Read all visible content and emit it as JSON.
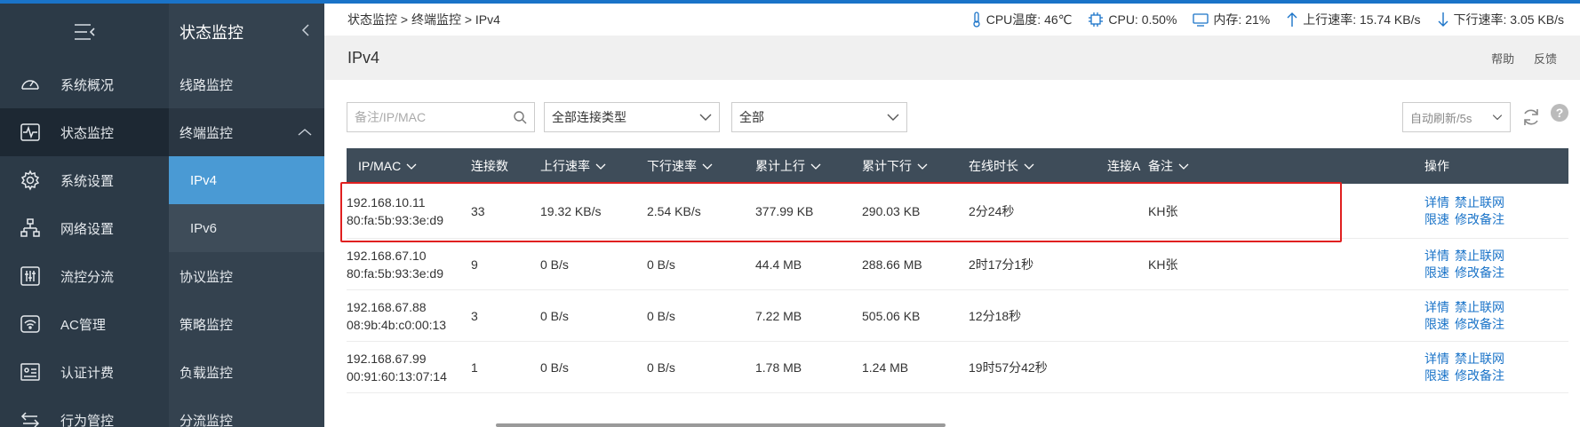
{
  "sidebar_main": {
    "items": [
      {
        "label": "系统概况",
        "icon": "gauge-icon"
      },
      {
        "label": "状态监控",
        "icon": "pulse-icon",
        "active": true
      },
      {
        "label": "系统设置",
        "icon": "gear-icon"
      },
      {
        "label": "网络设置",
        "icon": "network-icon"
      },
      {
        "label": "流控分流",
        "icon": "sliders-icon"
      },
      {
        "label": "AC管理",
        "icon": "wifi-icon"
      },
      {
        "label": "认证计费",
        "icon": "id-card-icon"
      },
      {
        "label": "行为管控",
        "icon": "arrows-icon"
      }
    ]
  },
  "sidebar_sub": {
    "title": "状态监控",
    "items": [
      {
        "label": "线路监控"
      },
      {
        "label": "终端监控",
        "open": true
      },
      {
        "label": "IPv4",
        "sub": true,
        "selected": true
      },
      {
        "label": "IPv6",
        "sub": true
      },
      {
        "label": "协议监控"
      },
      {
        "label": "策略监控"
      },
      {
        "label": "负载监控"
      },
      {
        "label": "分流监控"
      }
    ]
  },
  "breadcrumb": "状态监控 > 终端监控 > IPv4",
  "stats": {
    "cpu_temp": "CPU温度: 46℃",
    "cpu": "CPU: 0.50%",
    "mem": "内存: 21%",
    "up": "上行速率: 15.74 KB/s",
    "down": "下行速率: 3.05 KB/s"
  },
  "page": {
    "title": "IPv4",
    "help": "帮助",
    "feedback": "反馈"
  },
  "filters": {
    "search_placeholder": "备注/IP/MAC",
    "conn_type": "全部连接类型",
    "scope": "全部",
    "auto_refresh": "自动刷新/5s"
  },
  "table": {
    "headers": [
      "IP/MAC",
      "连接数",
      "上行速率",
      "下行速率",
      "累计上行",
      "累计下行",
      "在线时长",
      "连接A",
      "备注",
      "操作"
    ],
    "rows": [
      {
        "ip": "192.168.10.11",
        "mac": "80:fa:5b:93:3e:d9",
        "conns": "33",
        "up": "19.32 KB/s",
        "down": "2.54 KB/s",
        "total_up": "377.99 KB",
        "total_down": "290.03 KB",
        "online": "2分24秒",
        "note": "KH张"
      },
      {
        "ip": "192.168.67.10",
        "mac": "80:fa:5b:93:3e:d9",
        "conns": "9",
        "up": "0 B/s",
        "down": "0 B/s",
        "total_up": "44.4 MB",
        "total_down": "288.66 MB",
        "online": "2时17分1秒",
        "note": "KH张"
      },
      {
        "ip": "192.168.67.88",
        "mac": "08:9b:4b:c0:00:13",
        "conns": "3",
        "up": "0 B/s",
        "down": "0 B/s",
        "total_up": "7.22 MB",
        "total_down": "505.06 KB",
        "online": "12分18秒",
        "note": ""
      },
      {
        "ip": "192.168.67.99",
        "mac": "00:91:60:13:07:14",
        "conns": "1",
        "up": "0 B/s",
        "down": "0 B/s",
        "total_up": "1.78 MB",
        "total_down": "1.24 MB",
        "online": "19时57分42秒",
        "note": ""
      }
    ],
    "ops": {
      "detail": "详情",
      "block": "禁止联网",
      "limit": "限速",
      "edit_note": "修改备注"
    }
  }
}
